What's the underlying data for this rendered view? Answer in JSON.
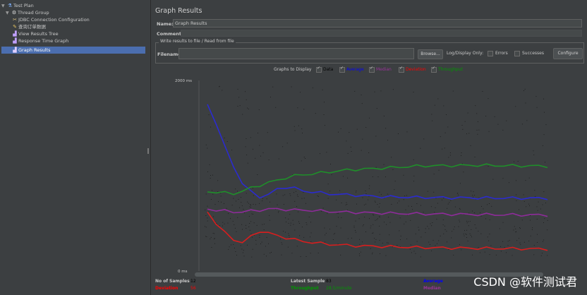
{
  "tree": {
    "items": [
      {
        "label": "Test Plan",
        "icon": "flask-icon",
        "depth": 0,
        "toggle": "▼"
      },
      {
        "label": "Thread Group",
        "icon": "gear-icon",
        "depth": 1,
        "toggle": "▼"
      },
      {
        "label": "JDBC Connection Configuration",
        "icon": "wrench-icon",
        "depth": 2,
        "toggle": ""
      },
      {
        "label": "查询订单数据",
        "icon": "pencil-icon",
        "depth": 2,
        "toggle": ""
      },
      {
        "label": "View Results Tree",
        "icon": "chart-icon",
        "depth": 2,
        "toggle": ""
      },
      {
        "label": "Response Time Graph",
        "icon": "chart-icon",
        "depth": 2,
        "toggle": ""
      },
      {
        "label": "Graph Results",
        "icon": "chart-icon",
        "depth": 2,
        "toggle": "",
        "selected": true
      }
    ]
  },
  "panel": {
    "title": "Graph Results",
    "name_label": "Name:",
    "name_value": "Graph Results",
    "comments_label": "Comments:",
    "comments_value": "",
    "file_group_title": "Write results to file / Read from file",
    "filename_label": "Filename",
    "filename_value": "",
    "browse_label": "Browse...",
    "log_display_label": "Log/Display Only:",
    "errors_label": "Errors",
    "successes_label": "Successes",
    "configure_label": "Configure"
  },
  "graphs_to_display": {
    "label": "Graphs to Display",
    "options": [
      {
        "label": "Data",
        "color": "#000000",
        "checked": true
      },
      {
        "label": "Average",
        "color": "#0000ff",
        "checked": true
      },
      {
        "label": "Median",
        "color": "#993399",
        "checked": true
      },
      {
        "label": "Deviation",
        "color": "#ff0000",
        "checked": true
      },
      {
        "label": "Throughput",
        "color": "#009900",
        "checked": true
      }
    ]
  },
  "chart_data": {
    "type": "line",
    "y_max_label": "2000",
    "y_min_label": "0",
    "y_unit": "ms",
    "ylim": [
      0,
      2000
    ],
    "grid": false,
    "series": [
      {
        "name": "Average",
        "color": "#2b2bd0",
        "values": [
          1750,
          1550,
          1300,
          1100,
          920,
          830,
          780,
          800,
          860,
          880,
          870,
          840,
          830,
          820,
          810,
          805,
          800,
          795,
          790,
          785,
          780,
          778,
          776,
          775,
          773,
          772,
          770,
          770,
          769,
          768,
          768,
          767,
          767,
          766,
          766,
          765,
          765,
          765,
          764,
          764
        ]
      },
      {
        "name": "Throughput",
        "color": "#1f8f2a",
        "values": [
          830,
          830,
          820,
          810,
          840,
          870,
          900,
          930,
          950,
          980,
          1000,
          1010,
          1020,
          1030,
          1040,
          1050,
          1060,
          1065,
          1070,
          1075,
          1080,
          1085,
          1090,
          1095,
          1100,
          1103,
          1105,
          1106,
          1107,
          1108,
          1109,
          1110,
          1110,
          1108,
          1106,
          1105,
          1104,
          1103,
          1102,
          1100
        ]
      },
      {
        "name": "Median",
        "color": "#8e2c9a",
        "values": [
          650,
          640,
          630,
          620,
          620,
          630,
          640,
          650,
          650,
          645,
          640,
          640,
          635,
          630,
          625,
          620,
          618,
          615,
          612,
          610,
          608,
          606,
          604,
          602,
          600,
          599,
          598,
          597,
          596,
          595,
          594,
          593,
          592,
          591,
          590,
          590,
          589,
          588,
          588,
          587
        ]
      },
      {
        "name": "Deviation",
        "color": "#d81e1e",
        "values": [
          620,
          500,
          400,
          330,
          300,
          360,
          420,
          400,
          370,
          350,
          330,
          310,
          300,
          290,
          280,
          275,
          270,
          265,
          262,
          260,
          258,
          255,
          252,
          250,
          248,
          246,
          244,
          243,
          242,
          241,
          240,
          239,
          238,
          237,
          236,
          235,
          234,
          233,
          232,
          231
        ]
      }
    ]
  },
  "footer": {
    "no_samples_label": "No of Samples",
    "no_samples_value": "12",
    "latest_sample_label": "Latest Sample",
    "latest_sample_value": "83",
    "deviation_label": "Deviation",
    "deviation_value": "56",
    "throughput_label": "Throughput",
    "throughput_value": "28,5/minute",
    "average_label": "Average",
    "median_label": "Median"
  },
  "watermark": "CSDN @软件测试君"
}
